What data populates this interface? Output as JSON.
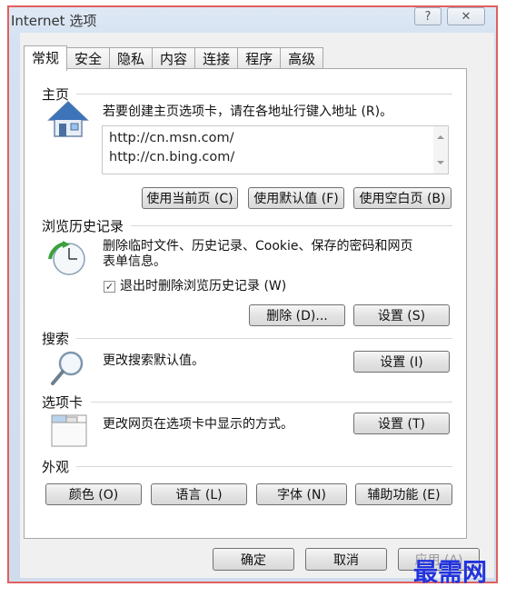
{
  "window": {
    "title": "Internet 选项",
    "help_label": "?",
    "close_label": "✕"
  },
  "tabs": [
    {
      "label": "常规",
      "active": true
    },
    {
      "label": "安全"
    },
    {
      "label": "隐私"
    },
    {
      "label": "内容"
    },
    {
      "label": "连接"
    },
    {
      "label": "程序"
    },
    {
      "label": "高级"
    }
  ],
  "home": {
    "section": "主页",
    "description": "若要创建主页选项卡，请在各地址行键入地址 (R)。",
    "urls": [
      "http://cn.msn.com/",
      "http://cn.bing.com/"
    ],
    "buttons": [
      "使用当前页 (C)",
      "使用默认值 (F)",
      "使用空白页 (B)"
    ],
    "icon": "house-icon"
  },
  "history": {
    "section": "浏览历史记录",
    "description_line1": "删除临时文件、历史记录、Cookie、保存的密码和网页",
    "description_line2": "表单信息。",
    "checkbox_label": "退出时删除浏览历史记录 (W)",
    "checkbox_checked": true,
    "delete_button": "删除 (D)...",
    "settings_button": "设置 (S)",
    "icon": "history-icon"
  },
  "search": {
    "section": "搜索",
    "description": "更改搜索默认值。",
    "settings_button": "设置 (I)",
    "icon": "magnifier-icon"
  },
  "tabs_section": {
    "section": "选项卡",
    "description": "更改网页在选项卡中显示的方式。",
    "settings_button": "设置 (T)",
    "icon": "tabs-window-icon"
  },
  "appearance": {
    "section": "外观",
    "buttons": [
      "颜色 (O)",
      "语言 (L)",
      "字体 (N)",
      "辅助功能 (E)"
    ]
  },
  "footer": {
    "ok": "确定",
    "cancel": "取消",
    "apply": "应用 (A)"
  },
  "watermark": "最需网"
}
